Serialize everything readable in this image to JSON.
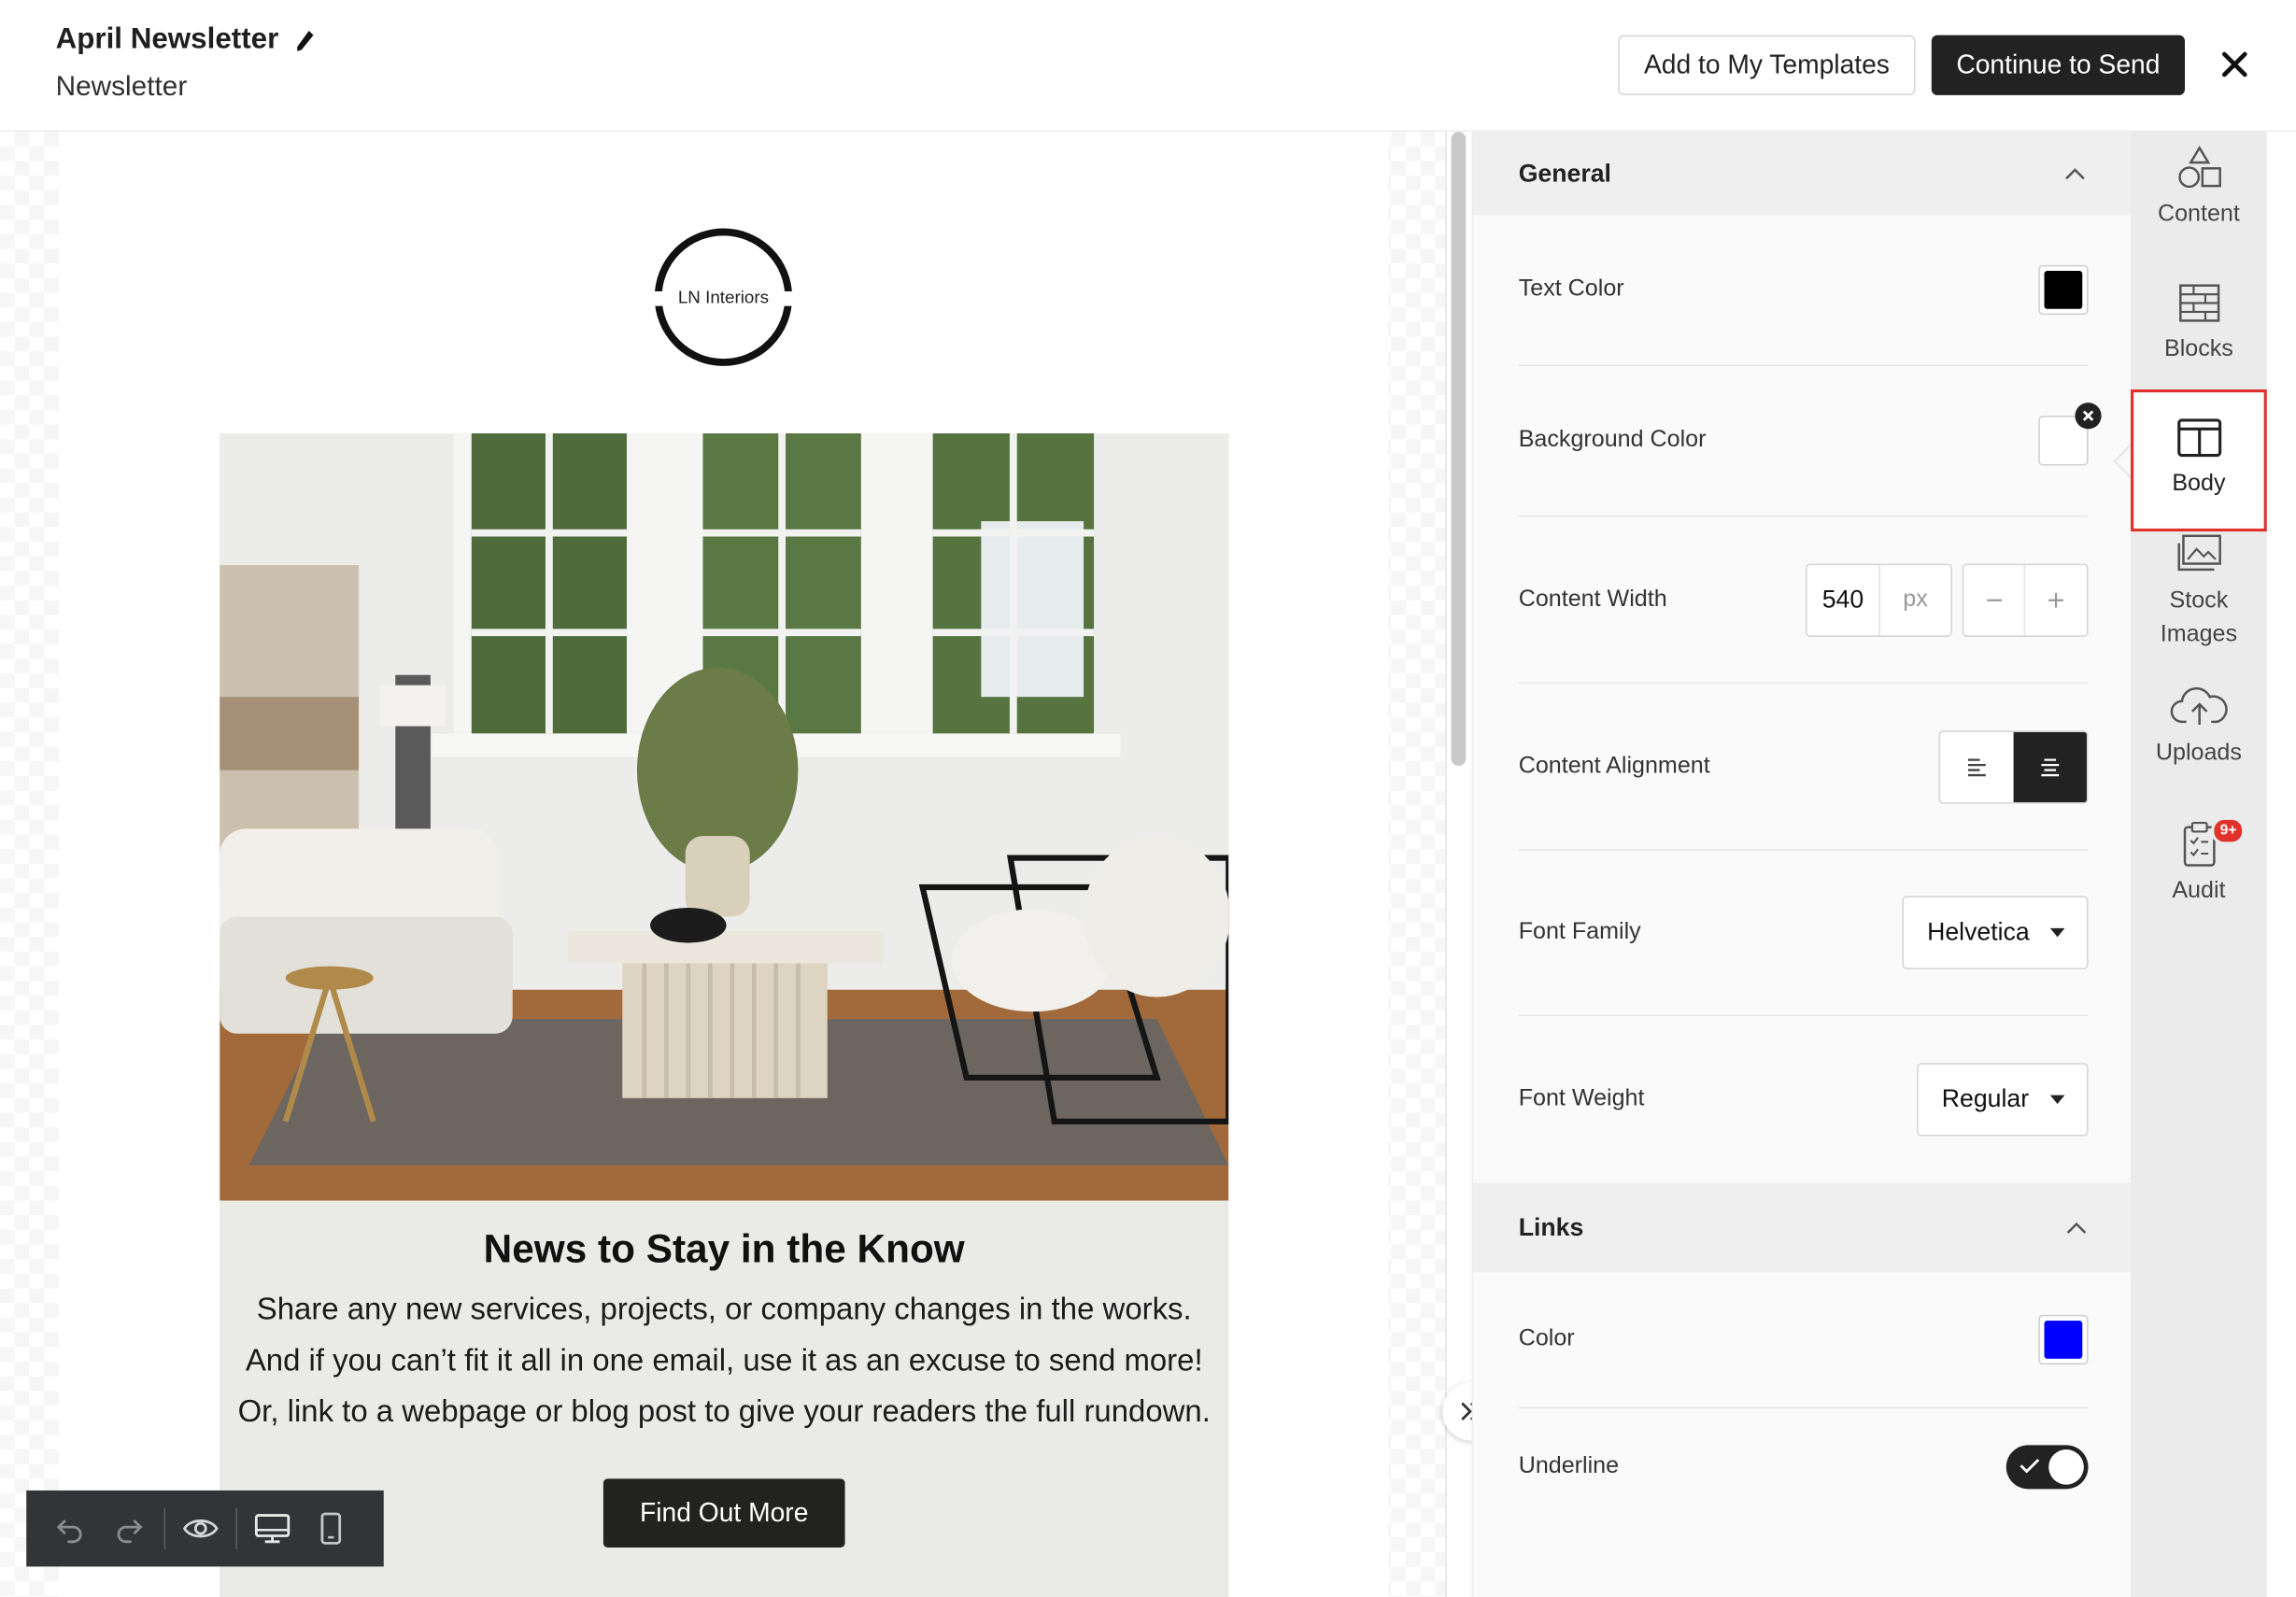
{
  "header": {
    "title": "April Newsletter",
    "subtitle": "Newsletter",
    "add_templates_label": "Add to My Templates",
    "continue_label": "Continue to Send"
  },
  "email": {
    "logo_text": "LN Interiors",
    "heading": "News to Stay in the Know",
    "body": "Share any new services, projects, or company changes in the works. And if you can’t fit it all in one email, use it as an excuse to send more! Or, link to a webpage or blog post to give your readers the full rundown.",
    "cta_label": "Find Out More"
  },
  "panel": {
    "general": {
      "title": "General",
      "text_color_label": "Text Color",
      "text_color": "#000000",
      "background_color_label": "Background Color",
      "background_color": "#ffffff",
      "content_width_label": "Content Width",
      "content_width_value": "540",
      "content_width_unit": "px",
      "content_alignment_label": "Content Alignment",
      "content_alignment": "center",
      "font_family_label": "Font Family",
      "font_family_value": "Helvetica",
      "font_weight_label": "Font Weight",
      "font_weight_value": "Regular"
    },
    "links": {
      "title": "Links",
      "color_label": "Color",
      "color": "#0000ff",
      "underline_label": "Underline",
      "underline": true
    }
  },
  "right_nav": {
    "items": [
      {
        "label": "Content",
        "icon": "shapes-icon"
      },
      {
        "label": "Blocks",
        "icon": "blocks-icon"
      },
      {
        "label": "Body",
        "icon": "body-layout-icon",
        "active": true
      },
      {
        "label": "Stock Images",
        "icon": "stock-images-icon"
      },
      {
        "label": "Uploads",
        "icon": "cloud-upload-icon"
      },
      {
        "label": "Audit",
        "icon": "clipboard-audit-icon",
        "badge": "9+"
      }
    ]
  },
  "colors": {
    "accent_dark": "#222222",
    "highlight": "#e0322b"
  }
}
